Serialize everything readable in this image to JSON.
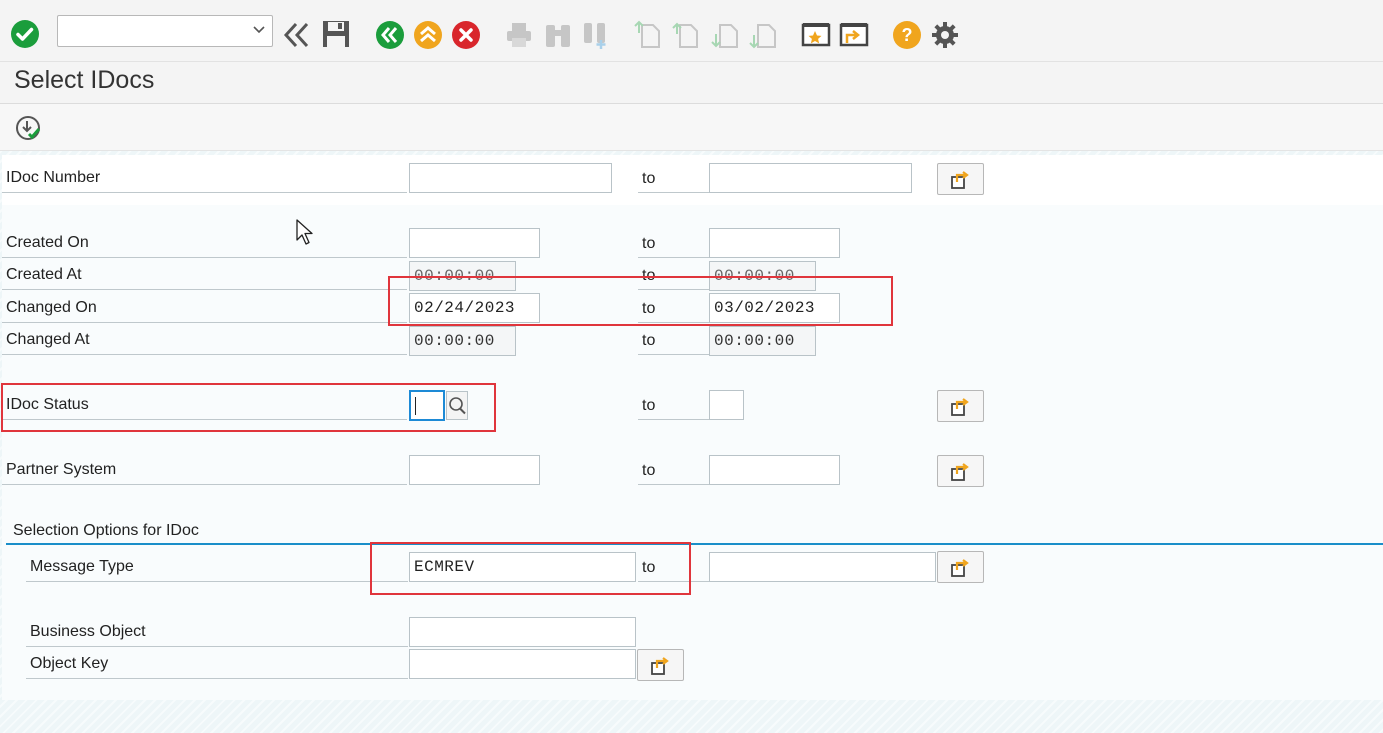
{
  "toolbar": {
    "command_field": {
      "value": "",
      "placeholder": ""
    },
    "icons": [
      "enter-icon",
      "back-double-icon",
      "save-icon",
      "back-icon",
      "exit-icon",
      "cancel-icon",
      "print-icon",
      "find-icon",
      "find-next-icon",
      "first-page-icon",
      "previous-page-icon",
      "next-page-icon",
      "last-page-icon",
      "new-session-icon",
      "create-shortcut-icon",
      "help-icon",
      "settings-icon"
    ]
  },
  "page": {
    "title": "Select IDocs"
  },
  "form": {
    "to_label": "to",
    "idoc_number": {
      "label": "IDoc Number",
      "from": "",
      "to": ""
    },
    "created_on": {
      "label": "Created On",
      "from": "",
      "to": ""
    },
    "created_at": {
      "label": "Created At",
      "from": "00:00:00",
      "to": "00:00:00"
    },
    "changed_on": {
      "label": "Changed On",
      "from": "02/24/2023",
      "to": "03/02/2023"
    },
    "changed_at": {
      "label": "Changed At",
      "from": "00:00:00",
      "to": "00:00:00"
    },
    "idoc_status": {
      "label": "IDoc Status",
      "from": "",
      "to": ""
    },
    "partner_system": {
      "label": "Partner System",
      "from": "",
      "to": ""
    }
  },
  "selection_options": {
    "title": "Selection Options for IDoc",
    "message_type": {
      "label": "Message Type",
      "from": "ECMREV",
      "to": ""
    },
    "business_object": {
      "label": "Business Object",
      "value": ""
    },
    "object_key": {
      "label": "Object Key",
      "value": ""
    }
  },
  "colors": {
    "highlight": "#e0353c",
    "accent": "#1a8ec9",
    "green": "#1b9d3c",
    "orange": "#f0a51e",
    "red": "#d9262c"
  }
}
